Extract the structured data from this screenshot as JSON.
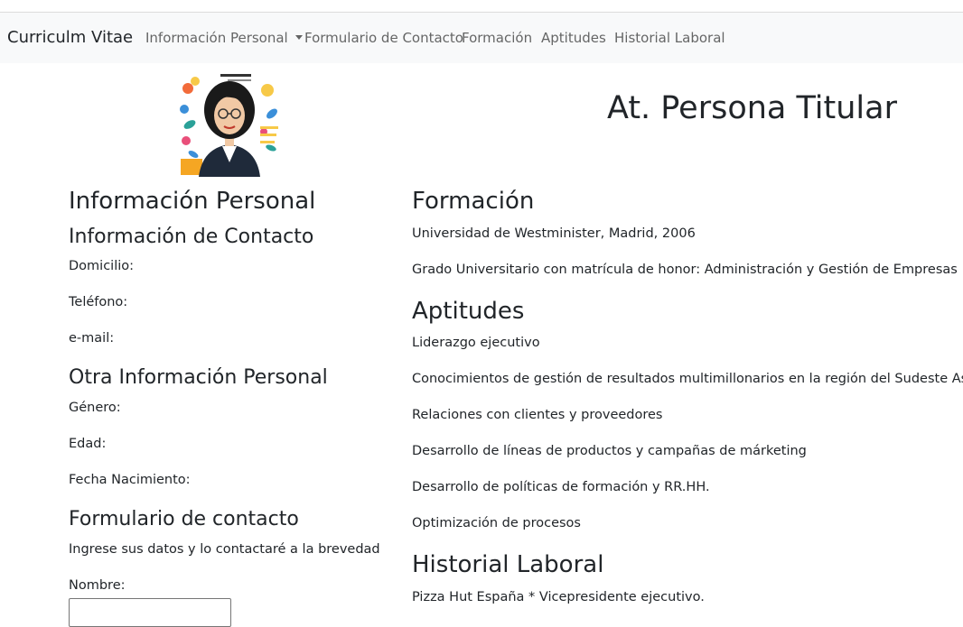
{
  "navbar": {
    "brand": "Curriculm Vitae",
    "items": [
      {
        "label": "Información Personal",
        "dropdown": true
      },
      {
        "label": "Formulario de Contacto"
      },
      {
        "label": "Formación"
      },
      {
        "label": "Aptitudes"
      },
      {
        "label": "Historial Laboral"
      }
    ]
  },
  "header": {
    "name": "At. Persona Titular"
  },
  "personal": {
    "heading": "Información Personal",
    "contact_heading": "Información de Contacto",
    "address_label": "Domicilio:",
    "phone_label": "Teléfono:",
    "email_label": "e-mail:",
    "other_heading": "Otra Información Personal",
    "gender_label": "Género:",
    "age_label": "Edad:",
    "birth_label": "Fecha Nacimiento:"
  },
  "contact_form": {
    "heading": "Formulario de contacto",
    "intro": "Ingrese sus datos y lo contactaré a la brevedad",
    "name_label": "Nombre:",
    "name_value": ""
  },
  "education": {
    "heading": "Formación",
    "items": [
      "Universidad de Westminister, Madrid, 2006",
      "Grado Universitario con matrícula de honor: Administración y Gestión de Empresas"
    ]
  },
  "skills": {
    "heading": "Aptitudes",
    "items": [
      "Liderazgo ejecutivo",
      "Conocimientos de gestión de resultados multimillonarios en la región del Sudeste Asiático",
      "Relaciones con clientes y proveedores",
      "Desarrollo de líneas de productos y campañas de márketing",
      "Desarrollo de políticas de formación y RR.HH.",
      "Optimización de procesos"
    ]
  },
  "work": {
    "heading": "Historial Laboral",
    "items": [
      "Pizza Hut España * Vicepresidente ejecutivo."
    ]
  }
}
